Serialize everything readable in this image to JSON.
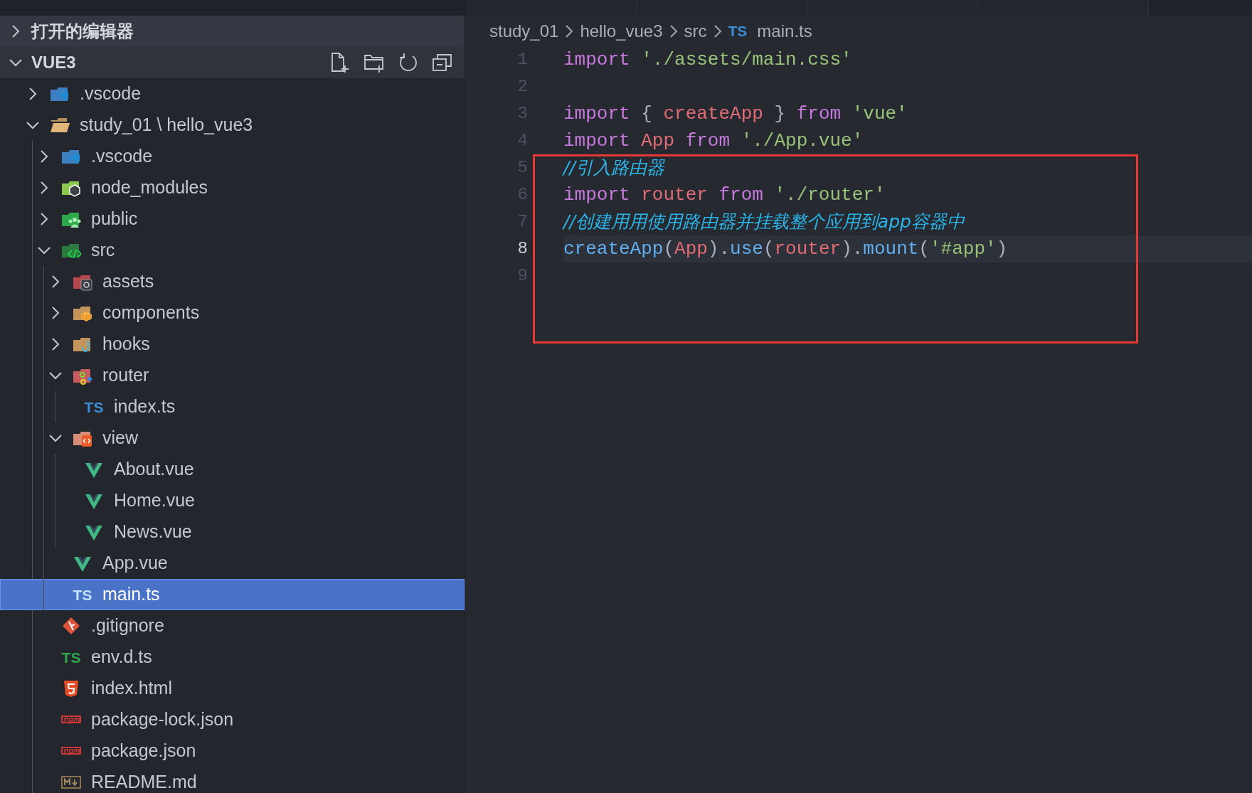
{
  "explorer": {
    "sections": [
      {
        "label": "打开的编辑器",
        "expanded": false
      },
      {
        "label": "VUE3",
        "expanded": true
      }
    ],
    "tree": [
      {
        "label": ".vscode",
        "kind": "folder-vscode",
        "expanded": false,
        "selected": false
      },
      {
        "label": "study_01 \\ hello_vue3",
        "kind": "folder-plain",
        "expanded": true,
        "selected": false,
        "children": [
          {
            "label": ".vscode",
            "kind": "folder-vscode",
            "expanded": false,
            "selected": false
          },
          {
            "label": "node_modules",
            "kind": "folder-node",
            "expanded": false,
            "selected": false
          },
          {
            "label": "public",
            "kind": "folder-public",
            "expanded": false,
            "selected": false
          },
          {
            "label": "src",
            "kind": "folder-src",
            "expanded": true,
            "selected": false,
            "children": [
              {
                "label": "assets",
                "kind": "folder-assets",
                "expanded": false,
                "selected": false
              },
              {
                "label": "components",
                "kind": "folder-components",
                "expanded": false,
                "selected": false
              },
              {
                "label": "hooks",
                "kind": "folder-hooks",
                "expanded": false,
                "selected": false
              },
              {
                "label": "router",
                "kind": "folder-router",
                "expanded": true,
                "selected": false,
                "children": [
                  {
                    "label": "index.ts",
                    "kind": "file-ts",
                    "badge": "TS",
                    "selected": false
                  }
                ]
              },
              {
                "label": "view",
                "kind": "folder-view",
                "expanded": true,
                "selected": false,
                "children": [
                  {
                    "label": "About.vue",
                    "kind": "file-vue",
                    "selected": false
                  },
                  {
                    "label": "Home.vue",
                    "kind": "file-vue",
                    "selected": false
                  },
                  {
                    "label": "News.vue",
                    "kind": "file-vue",
                    "selected": false
                  }
                ]
              },
              {
                "label": "App.vue",
                "kind": "file-vue",
                "selected": false
              },
              {
                "label": "main.ts",
                "kind": "file-ts",
                "badge": "TS",
                "selected": true
              }
            ]
          },
          {
            "label": ".gitignore",
            "kind": "file-git",
            "selected": false
          },
          {
            "label": "env.d.ts",
            "kind": "file-dts",
            "badge": "TS",
            "selected": false
          },
          {
            "label": "index.html",
            "kind": "file-html",
            "selected": false
          },
          {
            "label": "package-lock.json",
            "kind": "file-npm",
            "selected": false
          },
          {
            "label": "package.json",
            "kind": "file-npm",
            "selected": false
          },
          {
            "label": "README.md",
            "kind": "file-md",
            "selected": false
          }
        ]
      }
    ]
  },
  "editor": {
    "breadcrumb": [
      {
        "label": "study_01"
      },
      {
        "label": "hello_vue3"
      },
      {
        "label": "src"
      },
      {
        "label": "main.ts",
        "badge": "TS"
      }
    ],
    "lines": [
      {
        "number": "1",
        "current": false,
        "tokens": [
          {
            "text": "import",
            "kind": "keyword"
          },
          {
            "text": "'./assets/main.css'",
            "kind": "string",
            "gap_before": true
          }
        ]
      },
      {
        "number": "2",
        "current": false
      },
      {
        "number": "3",
        "current": false,
        "tokens": [
          {
            "text": "import",
            "kind": "keyword"
          },
          {
            "text": " { ",
            "kind": "plain"
          },
          {
            "text": "createApp",
            "kind": "variable"
          },
          {
            "text": " } ",
            "kind": "plain"
          },
          {
            "text": "from",
            "kind": "keyword"
          },
          {
            "text": "'vue'",
            "kind": "string",
            "gap_before": true
          }
        ]
      },
      {
        "number": "4",
        "current": false,
        "tokens": [
          {
            "text": "import",
            "kind": "keyword"
          },
          {
            "text": "App",
            "kind": "variable",
            "gap_before": true
          },
          {
            "text": "from",
            "kind": "keyword",
            "gap_before": true
          },
          {
            "text": "'./App.vue'",
            "kind": "string",
            "gap_before": true
          }
        ]
      },
      {
        "number": "5",
        "current": false,
        "tokens": [
          {
            "text": "//引入路由器",
            "kind": "comment"
          }
        ]
      },
      {
        "number": "6",
        "current": false,
        "tokens": [
          {
            "text": "import",
            "kind": "keyword"
          },
          {
            "text": "router",
            "kind": "variable",
            "gap_before": true
          },
          {
            "text": "from",
            "kind": "keyword",
            "gap_before": true
          },
          {
            "text": "'./router'",
            "kind": "string",
            "gap_before": true
          }
        ]
      },
      {
        "number": "7",
        "current": false,
        "tokens": [
          {
            "text": "//创建用用使用路由器并挂载整个应用到app容器中",
            "kind": "comment"
          }
        ]
      },
      {
        "number": "8",
        "current": true,
        "tokens": [
          {
            "text": "createApp",
            "kind": "function"
          },
          {
            "text": "(",
            "kind": "plain"
          },
          {
            "text": "App",
            "kind": "variable"
          },
          {
            "text": ").",
            "kind": "plain"
          },
          {
            "text": "use",
            "kind": "function"
          },
          {
            "text": "(",
            "kind": "plain"
          },
          {
            "text": "router",
            "kind": "variable"
          },
          {
            "text": ").",
            "kind": "plain"
          },
          {
            "text": "mount",
            "kind": "function"
          },
          {
            "text": "(",
            "kind": "plain"
          },
          {
            "text": "'#app'",
            "kind": "string"
          },
          {
            "text": ")",
            "kind": "plain"
          }
        ]
      },
      {
        "number": "9",
        "current": false
      }
    ]
  }
}
